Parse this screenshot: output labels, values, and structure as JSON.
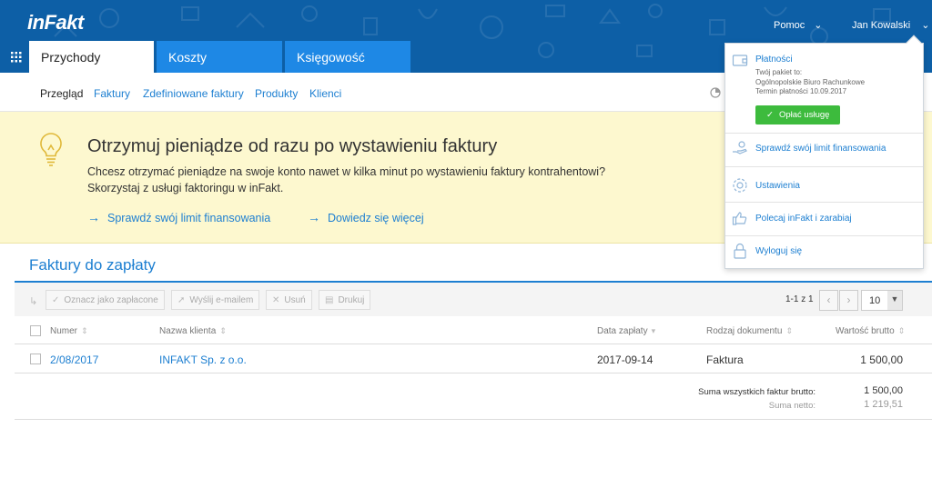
{
  "header": {
    "logo": "inFakt",
    "help": "Pomoc",
    "user": "Jan Kowalski",
    "tabs": [
      "Przychody",
      "Koszty",
      "Księgowość"
    ]
  },
  "subnav": [
    "Przegląd",
    "Faktury",
    "Zdefiniowane faktury",
    "Produkty",
    "Klienci"
  ],
  "banner": {
    "title": "Otrzymuj pieniądze od razu po wystawieniu faktury",
    "line1": "Chcesz otrzymać pieniądze na swoje konto nawet w kilka minut po wystawieniu faktury kontrahentowi?",
    "line2": "Skorzystaj z usługi faktoringu w inFakt.",
    "link1": "Sprawdź swój limit finansowania",
    "link2": "Dowiedz się więcej"
  },
  "section": {
    "title": "Faktury do zapłaty"
  },
  "toolbar": {
    "mark_paid": "Oznacz jako zapłacone",
    "send_email": "Wyślij e-mailem",
    "delete": "Usuń",
    "print": "Drukuj",
    "pager": "1-1 z 1",
    "per_page": "10"
  },
  "table": {
    "headers": [
      "Numer",
      "Nazwa klienta",
      "Data zapłaty",
      "Rodzaj dokumentu",
      "Wartość brutto"
    ],
    "rows": [
      {
        "number": "2/08/2017",
        "client": "INFAKT Sp. z o.o.",
        "date": "2017-09-14",
        "type": "Faktura",
        "gross": "1 500,00"
      }
    ],
    "sum_gross_label": "Suma wszystkich faktur brutto:",
    "sum_gross": "1 500,00",
    "sum_net_label": "Suma netto:",
    "sum_net": "1 219,51"
  },
  "dropdown": {
    "payments": "Płatności",
    "package_label": "Twój pakiet to:",
    "package_name": "Ogólnopolskie Biuro Rachunkowe",
    "due": "Termin płatności 10.09.2017",
    "pay_button": "Opłać usługę",
    "limit": "Sprawdź swój limit finansowania",
    "settings": "Ustawienia",
    "refer": "Polecaj inFakt i zarabiaj",
    "logout": "Wyloguj się"
  },
  "colors": {
    "header_blue": "#0d5fa6",
    "tab_blue": "#1e88e5",
    "link_blue": "#1d7fd1",
    "banner_yellow": "#fdf8cf",
    "pay_green": "#3dbb3d"
  }
}
